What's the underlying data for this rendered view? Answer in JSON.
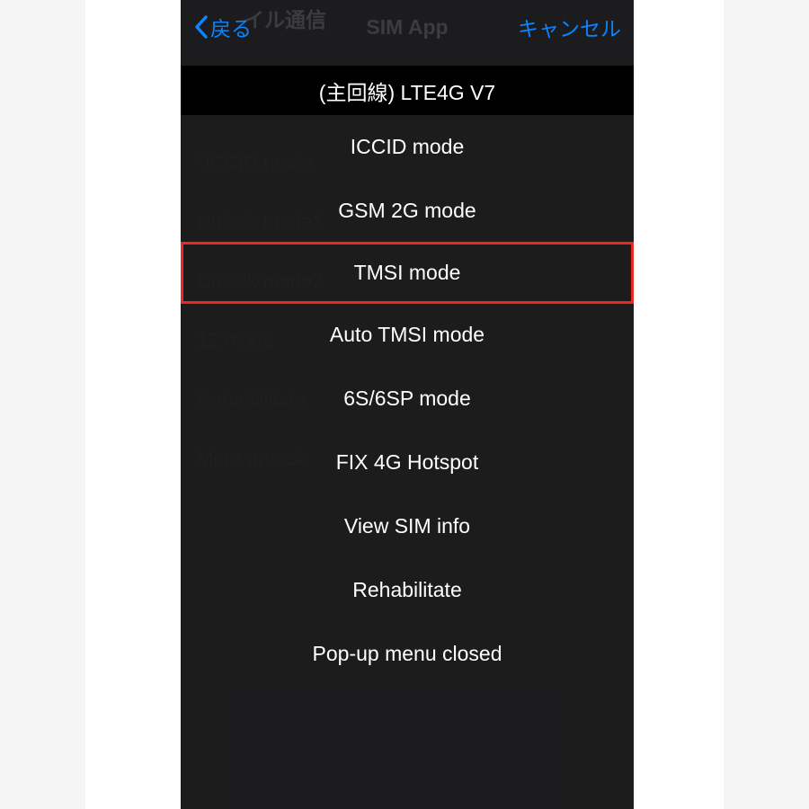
{
  "navbar": {
    "back_label": "戻る",
    "bg_text": "イル通信",
    "title": "SIM App",
    "cancel_label": "キャンセル"
  },
  "background_menu": {
    "items": [
      {
        "label": "LTE4G V7"
      },
      {
        "label": "*ICCID mode"
      },
      {
        "label": "Unlock mode1"
      },
      {
        "label": "Unlock mode2"
      },
      {
        "label": "12 mode"
      },
      {
        "label": "Rehabiilitate"
      },
      {
        "label": "More unlock"
      }
    ]
  },
  "action_sheet": {
    "title": "(主回線) LTE4G V7",
    "highlighted_index": 2,
    "options": [
      {
        "label": "ICCID mode"
      },
      {
        "label": "GSM 2G mode"
      },
      {
        "label": "TMSI mode"
      },
      {
        "label": "Auto TMSI mode"
      },
      {
        "label": "6S/6SP mode"
      },
      {
        "label": "FIX 4G Hotspot"
      },
      {
        "label": "View SIM info"
      },
      {
        "label": "Rehabilitate"
      },
      {
        "label": "Pop-up menu closed"
      }
    ]
  },
  "colors": {
    "accent": "#0a84ff",
    "highlight_border": "#f22424",
    "bg": "#1c1c1e"
  }
}
